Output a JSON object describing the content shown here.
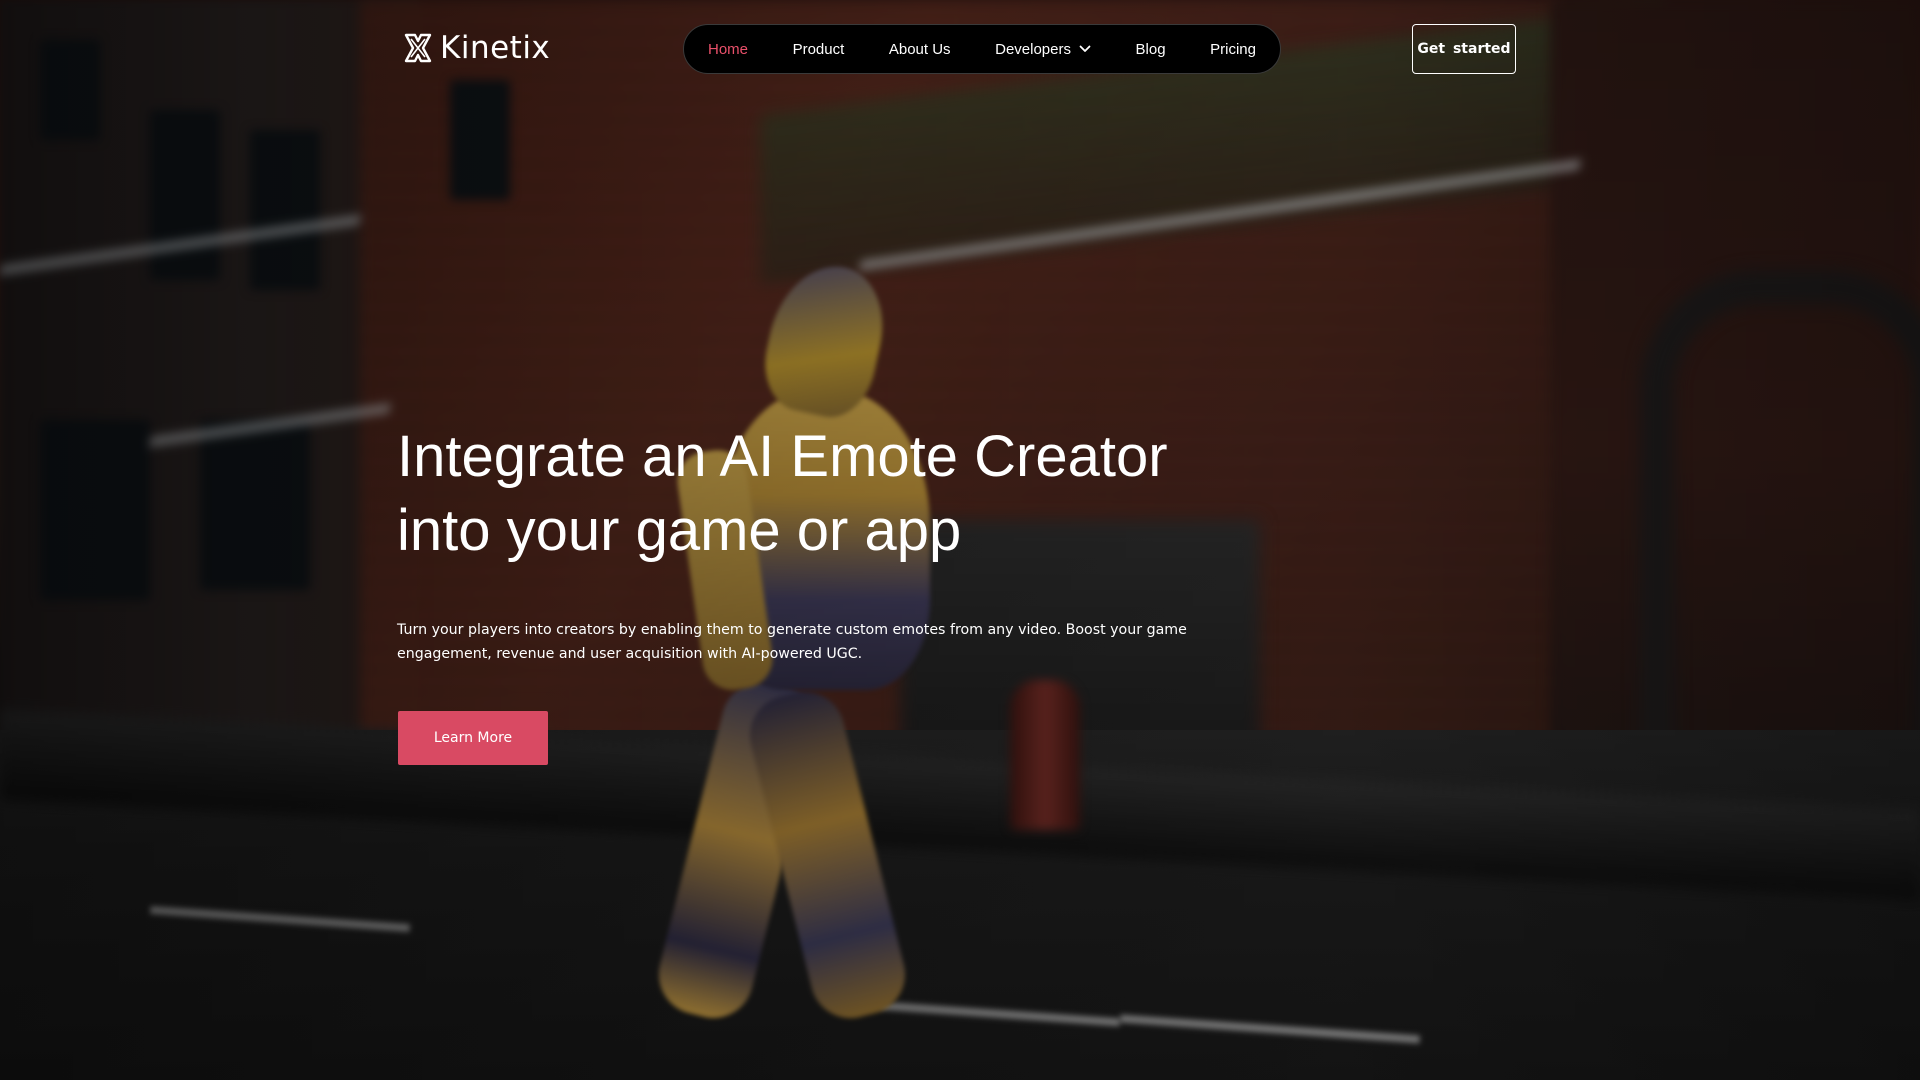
{
  "brand": {
    "name": "Kinetix",
    "logo_icon": "kinetix-x-logo-icon"
  },
  "nav": {
    "items": [
      {
        "label": "Home",
        "active": true
      },
      {
        "label": "Product",
        "active": false
      },
      {
        "label": "About Us",
        "active": false
      },
      {
        "label": "Developers",
        "active": false,
        "has_dropdown": true,
        "icon": "chevron-down-icon"
      },
      {
        "label": "Blog",
        "active": false
      },
      {
        "label": "Pricing",
        "active": false
      }
    ],
    "cta_label": "Get started"
  },
  "hero": {
    "title_line1": "Integrate an AI Emote Creator",
    "title_line2": "into your game or app",
    "subtitle": "Turn your players into creators by enabling them to generate custom emotes from any video. Boost your game engagement, revenue and user acquisition with AI-powered UGC.",
    "cta_label": "Learn More"
  },
  "colors": {
    "accent": "#d94a63",
    "nav_active": "#e9506a",
    "nav_bg": "#000000",
    "text": "#ffffff"
  }
}
